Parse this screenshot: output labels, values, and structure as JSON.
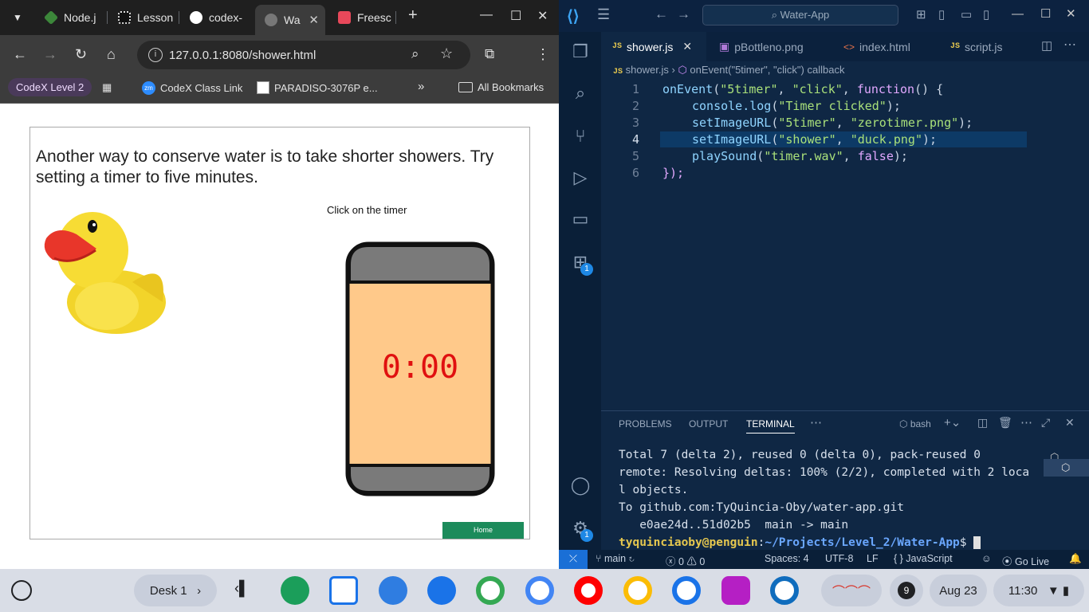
{
  "browser": {
    "tabs": [
      {
        "label": "Node.j",
        "color": "#3c873a"
      },
      {
        "label": "Lesson",
        "color": "#333333"
      },
      {
        "label": "codex-",
        "color": "#333333"
      },
      {
        "label": "Wa",
        "color": "#888888"
      },
      {
        "label": "Freesc",
        "color": "#e8485a"
      }
    ],
    "url": "127.0.0.1:8080/shower.html",
    "bookmarks": {
      "profile": "CodeX Level 2",
      "items": [
        "CodeX Class Link",
        "PARADISO-3076P e..."
      ],
      "more": "»",
      "all": "All Bookmarks"
    }
  },
  "app_page": {
    "heading": "Another way to conserve water is to take shorter showers. Try setting a timer to five minutes.",
    "click_label": "Click on the timer",
    "timer_display": "0:00",
    "home_button": "Home"
  },
  "vscode": {
    "search": "Water-App",
    "tabs": [
      {
        "label": "shower.js",
        "kind": "JS"
      },
      {
        "label": "pBottleno.png",
        "kind": "img"
      },
      {
        "label": "index.html",
        "kind": "html"
      },
      {
        "label": "script.js",
        "kind": "JS"
      }
    ],
    "breadcrumb": {
      "file": "shower.js",
      "sep": "›",
      "symbol": "onEvent(\"5timer\", \"click\") callback"
    },
    "code_lines": [
      "1",
      "2",
      "3",
      "4",
      "5",
      "6"
    ],
    "code": {
      "l1_fn": "onEvent",
      "l1_a": "\"5timer\"",
      "l1_b": "\"click\"",
      "l1_kw": "function",
      "l2_fn": "console.log",
      "l2_a": "\"Timer clicked\"",
      "l3_fn": "setImageURL",
      "l3_a": "\"5timer\"",
      "l3_b": "\"zerotimer.png\"",
      "l4_fn": "setImageURL",
      "l4_a": "\"shower\"",
      "l4_b": "\"duck.png\"",
      "l5_fn": "playSound",
      "l5_a": "\"timer.wav\"",
      "l5_b": "false",
      "l6": "});"
    },
    "panel_tabs": [
      "PROBLEMS",
      "OUTPUT",
      "TERMINAL"
    ],
    "shell": "bash",
    "terminal": [
      "Total 7 (delta 2), reused 0 (delta 0), pack-reused 0",
      "remote: Resolving deltas: 100% (2/2), completed with 2 loca",
      "l objects.",
      "To github.com:TyQuincia-Oby/water-app.git",
      "   e0ae24d..51d02b5  main -> main"
    ],
    "prompt_user": "tyquinciaoby@penguin",
    "prompt_path": "~/Projects/Level_2/Water-App",
    "prompt_sym": "$",
    "status": {
      "branch": "main",
      "errors": "0",
      "warnings": "0",
      "spaces": "Spaces: 4",
      "encoding": "UTF-8",
      "eol": "LF",
      "lang": "JavaScript",
      "golive": "Go Live"
    },
    "badge": "1"
  },
  "shelf": {
    "desk": "Desk 1",
    "notif": "9",
    "date": "Aug 23",
    "time": "11:30",
    "apps": [
      {
        "name": "app-launcher-apps",
        "color": "#1b9e5a"
      },
      {
        "name": "calendar",
        "color": "#ffffff"
      },
      {
        "name": "files",
        "color": "#2f7de1"
      },
      {
        "name": "chat",
        "color": "#1a73e8"
      },
      {
        "name": "meet",
        "color": "#ffffff"
      },
      {
        "name": "play-store",
        "color": "#ffffff"
      },
      {
        "name": "youtube",
        "color": "#ffffff"
      },
      {
        "name": "photos",
        "color": "#ffffff"
      },
      {
        "name": "vscode",
        "color": "#ffffff"
      },
      {
        "name": "app-purple",
        "color": "#b51fc4"
      },
      {
        "name": "outlook",
        "color": "#ffffff"
      }
    ]
  }
}
